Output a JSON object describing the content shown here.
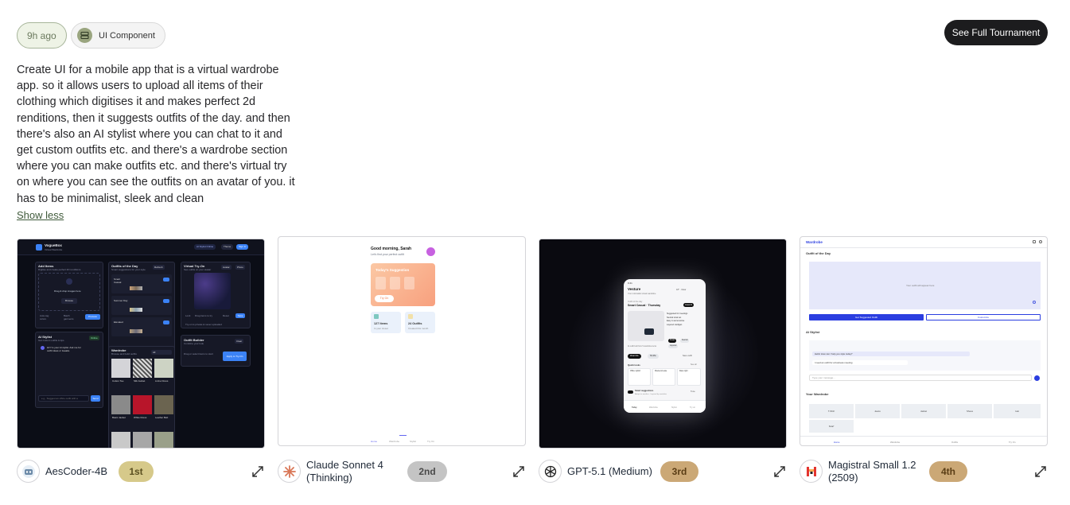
{
  "header": {
    "time_ago": "9h ago",
    "category": "UI Component",
    "cta": "See Full Tournament"
  },
  "prompt": {
    "lines": [
      "Create UI for a mobile app that is a virtual wardrobe",
      "app. so it allows users to upload all items of their",
      "clothing which digitises it and makes perfect 2d",
      "renditions, then it suggests outfits of the day. and then",
      "there's also an AI stylist where you can chat to it and",
      "get custom outfits etc. and there's a wardrobe section",
      "where you can make outfits etc. and there's virtual try",
      "on where you can see the outfits on an avatar of you. it",
      "has to be minimalist, sleek and clean"
    ],
    "toggle": "Show less"
  },
  "entries": [
    {
      "model": "AesCoder-4B",
      "model_line2": "",
      "rank": "1st",
      "badge_color": "#d6c98a",
      "preview": {
        "brand": "VogueBox",
        "tagline": "Virtual Wardrobe",
        "btn_ai": "AI Stylist Online",
        "btn_theme": "Theme",
        "btn_sign": "Sign In",
        "add_title": "Add Items",
        "add_sub": "Digitise and create perfect 2D renditions",
        "add_drop": "Drag & drop images here",
        "add_browse": "Browse",
        "add_auto": "Auto-tag colors",
        "add_batch": "Batch garments",
        "add_process": "Process",
        "ootd_title": "Outfits of the Day",
        "ootd_sub": "Smart suggestions for your style",
        "ootd_refresh": "Refresh",
        "ootd_items": [
          "Smart Casual",
          "Summer Day",
          "Elevated"
        ],
        "tryon_title": "Virtual Try-On",
        "tryon_sub": "See outfits on your avatar",
        "tryon_avatar": "Avatar",
        "tryon_photo": "Photo",
        "tryon_lock": "Lock",
        "tryon_drag": "Drag items to try",
        "tryon_reset": "Reset",
        "tryon_save": "Save",
        "tryon_note": "Try-on is private & never uploaded",
        "stylist_title": "AI Stylist",
        "stylist_sub": "Get custom outfits & tips",
        "stylist_online": "Online",
        "stylist_msg": "Hi! I'm your AI stylist. Ask me for outfit ideas or tweaks.",
        "stylist_input": "e.g., Suggest an office outfit with a",
        "stylist_send": "Send",
        "wardrobe_title": "Wardrobe",
        "wardrobe_sub": "Browse and build outfits",
        "wardrobe_filter": "All",
        "wardrobe_items": [
          "Cotton Tee",
          "Silk Jacket",
          "A-line Dress",
          "Basic Jacket",
          "White Dress",
          "Leather Belt"
        ],
        "builder_title": "Outfit Builder",
        "builder_sub": "Combine your look",
        "builder_clear": "Clear",
        "builder_hint": "Drag or select items to start",
        "builder_apply": "Apply to Try-On"
      }
    },
    {
      "model": "Claude Sonnet 4",
      "model_line2": "(Thinking)",
      "rank": "2nd",
      "badge_color": "#c4c4c4",
      "preview": {
        "greeting": "Good morning, Sarah",
        "sub": "Let's find your perfect outfit",
        "suggestion_title": "Today's Suggestion",
        "try_on": "Try On",
        "stat1_value": "127 Items",
        "stat1_label": "In your closet",
        "stat2_value": "24 Outfits",
        "stat2_label": "Created this month",
        "nav": [
          "Home",
          "Wardrobe",
          "Stylist",
          "Try On"
        ]
      }
    },
    {
      "model": "GPT-5.1 (Medium)",
      "model_line2": "",
      "rank": "3rd",
      "badge_color": "#cba876",
      "preview": {
        "time": "9:41",
        "app": "Vesture",
        "app_sub": "Your minimalist virtual wardrobe",
        "weather": "18° · Clear",
        "section": "Outfit of the day",
        "outfit_name": "Smart Casual · Thursday",
        "outfit_tag": "Great fit",
        "bullets": [
          "Suggested for meetings",
          "Neutral tonal set",
          "Easy to accessorise",
          "Layered cardigan"
        ],
        "chips": [
          "Smart",
          "Neutral",
          "Layered"
        ],
        "note": "AI outfit built from 5 wardrobe items",
        "btn_wear": "Wear this",
        "btn_shuffle": "Shuffle",
        "btn_save": "Save outfit",
        "quick_title": "Quick looks",
        "quick_more": "See all",
        "quick": [
          "Office stylish",
          "Weekend ease",
          "Date night"
        ],
        "smart_title": "Smart suggestions",
        "smart_sub": "Adapts to weather · Inspired by wardrobe",
        "smart_cta": "Tune",
        "nav": [
          "Today",
          "Wardrobe",
          "Stylist",
          "Try on"
        ]
      }
    },
    {
      "model": "Magistral Small 1.2",
      "model_line2": "(2509)",
      "rank": "4th",
      "badge_color": "#cba876",
      "preview": {
        "brand": "Wardrobe",
        "ootd_title": "Outfit of the Day",
        "ootd_placeholder": "Your outfit will appear here",
        "btn_suggest": "Get Suggested Outfit",
        "btn_customize": "Customize",
        "stylist_title": "AI Stylist",
        "chat_bot": "Hello! How can I help you style today?",
        "chat_user": "I need an outfit for a business meeting",
        "chat_input": "Type your message...",
        "wardrobe_title": "Your Wardrobe",
        "items": [
          "T-Shirt",
          "Jeans",
          "Jacket",
          "Shoes",
          "Hat",
          "Scarf"
        ],
        "nav": [
          "Home",
          "Wardrobe",
          "Outfits",
          "Try On"
        ]
      }
    }
  ],
  "colors": {
    "cta_bg": "#1c1c1e",
    "pill_time_bg": "#eef3e6",
    "rank_gold": "#d6c98a",
    "rank_silver": "#c4c4c4",
    "rank_bronze": "#cba876",
    "accent_blue": "#3b82f6",
    "magistral_blue": "#2b3ee0"
  }
}
